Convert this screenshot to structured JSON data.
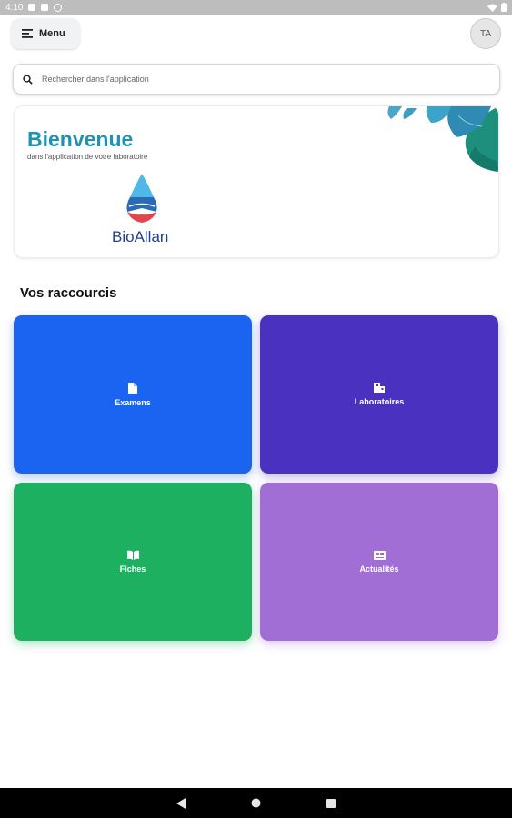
{
  "status_bar": {
    "time": "4:10"
  },
  "header": {
    "menu_label": "Menu",
    "avatar_initials": "TA"
  },
  "search": {
    "placeholder": "Rechercher dans l'application"
  },
  "welcome": {
    "title": "Bienvenue",
    "subtitle": "dans l'application de votre laboratoire",
    "brand": "BioAllan"
  },
  "shortcuts": {
    "title": "Vos raccourcis",
    "tiles": [
      {
        "label": "Examens",
        "icon": "document-icon",
        "color": "#1b63f1"
      },
      {
        "label": "Laboratoires",
        "icon": "laboratory-icon",
        "color": "#4b31c0"
      },
      {
        "label": "Fiches",
        "icon": "open-book-icon",
        "color": "#1cb060"
      },
      {
        "label": "Actualités",
        "icon": "newspaper-icon",
        "color": "#a06ed4"
      }
    ]
  },
  "colors": {
    "accent_title": "#1e93b2",
    "brand_text": "#233f8f"
  }
}
